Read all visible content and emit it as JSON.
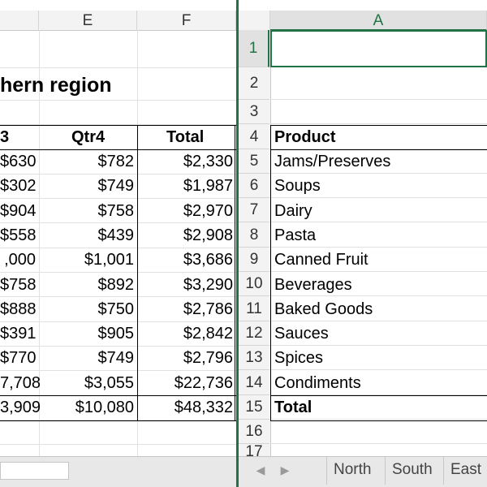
{
  "left_pane": {
    "columns": [
      "E",
      "F"
    ],
    "title_fragment": "hern region",
    "header": {
      "qtr3": "3",
      "qtr4": "Qtr4",
      "total": "Total"
    },
    "rows": [
      {
        "qtr3": "$630",
        "qtr4": "$782",
        "total": "$2,330"
      },
      {
        "qtr3": "$302",
        "qtr4": "$749",
        "total": "$1,987"
      },
      {
        "qtr3": "$904",
        "qtr4": "$758",
        "total": "$2,970"
      },
      {
        "qtr3": "$558",
        "qtr4": "$439",
        "total": "$2,908"
      },
      {
        "qtr3": ",000",
        "qtr4": "$1,001",
        "total": "$3,686"
      },
      {
        "qtr3": "$758",
        "qtr4": "$892",
        "total": "$3,290"
      },
      {
        "qtr3": "$888",
        "qtr4": "$750",
        "total": "$2,786"
      },
      {
        "qtr3": "$391",
        "qtr4": "$905",
        "total": "$2,842"
      },
      {
        "qtr3": "$770",
        "qtr4": "$749",
        "total": "$2,796"
      },
      {
        "qtr3": "7,708",
        "qtr4": "$3,055",
        "total": "$22,736"
      }
    ],
    "total_row": {
      "qtr3": "3,909",
      "qtr4": "$10,080",
      "total": "$48,332"
    }
  },
  "right_pane": {
    "column": "A",
    "row_numbers": [
      "1",
      "2",
      "3",
      "4",
      "5",
      "6",
      "7",
      "8",
      "9",
      "10",
      "11",
      "12",
      "13",
      "14",
      "15",
      "16",
      "17"
    ],
    "header": "Product",
    "products": [
      "Jams/Preserves",
      "Soups",
      "Dairy",
      "Pasta",
      "Canned Fruit",
      "Beverages",
      "Baked Goods",
      "Sauces",
      "Spices",
      "Condiments"
    ],
    "total_label": "Total"
  },
  "sheet_tabs": [
    "North",
    "South",
    "East"
  ],
  "colors": {
    "accent": "#217346",
    "gridline": "#e1e1e1",
    "header_bg": "#f3f3f3"
  }
}
